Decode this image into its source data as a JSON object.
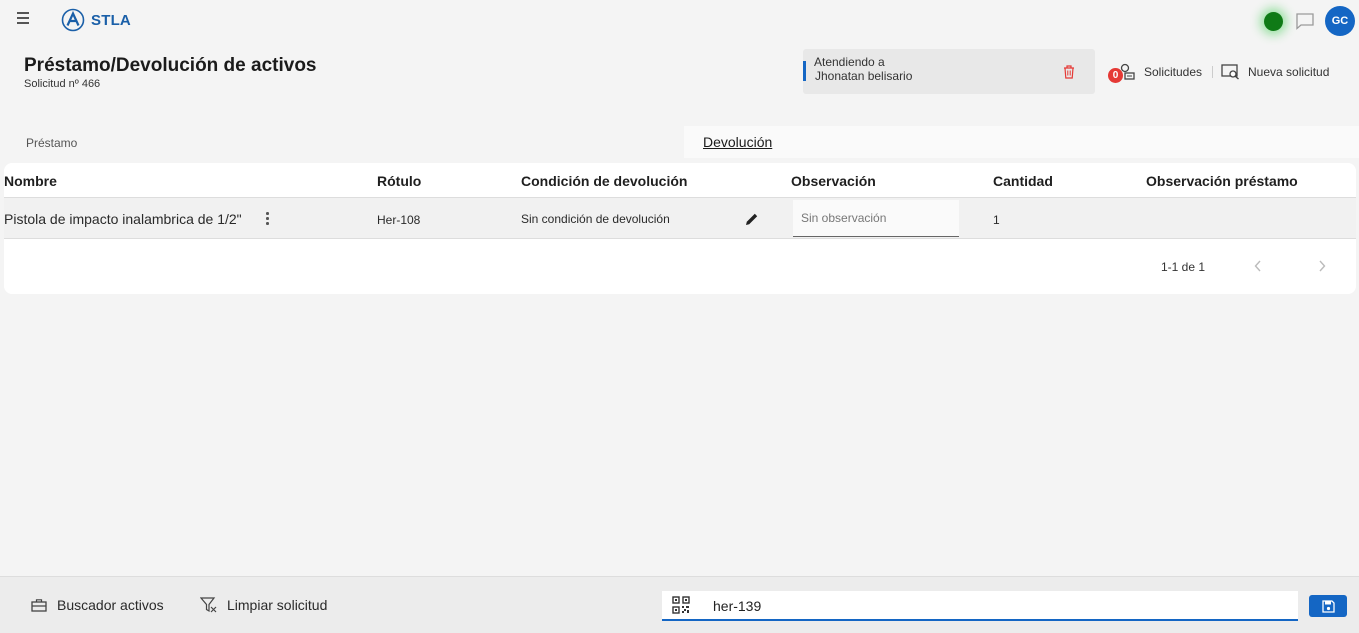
{
  "header": {
    "brand": "STLA",
    "avatar_initials": "GC",
    "status_color": "#0f7a16"
  },
  "page": {
    "title": "Préstamo/Devolución de activos",
    "subtitle": "Solicitud nº 466"
  },
  "attending": {
    "label": "Atendiendo a",
    "name": "Jhonatan belisario"
  },
  "actions": {
    "requests_badge": "0",
    "requests_label": "Solicitudes",
    "new_request_label": "Nueva solicitud"
  },
  "tabs": [
    {
      "label": "Préstamo",
      "active": false
    },
    {
      "label": "Devolución",
      "active": true
    }
  ],
  "table": {
    "columns": [
      "Nombre",
      "Rótulo",
      "Condición de devolución",
      "Observación",
      "Cantidad",
      "Observación préstamo"
    ],
    "rows": [
      {
        "nombre": "Pistola de impacto inalambrica de 1/2\"",
        "rotulo": "Her-108",
        "condicion": "Sin condición de devolución",
        "observacion_placeholder": "Sin observación",
        "cantidad": "1",
        "observacion_prestamo": ""
      }
    ],
    "pagination": "1-1 de 1"
  },
  "footer": {
    "search_assets_label": "Buscador activos",
    "clear_request_label": "Limpiar solicitud",
    "scan_value": "her-139"
  },
  "colors": {
    "accent": "#1466c4",
    "badge": "#e53935",
    "trash": "#e53935"
  }
}
